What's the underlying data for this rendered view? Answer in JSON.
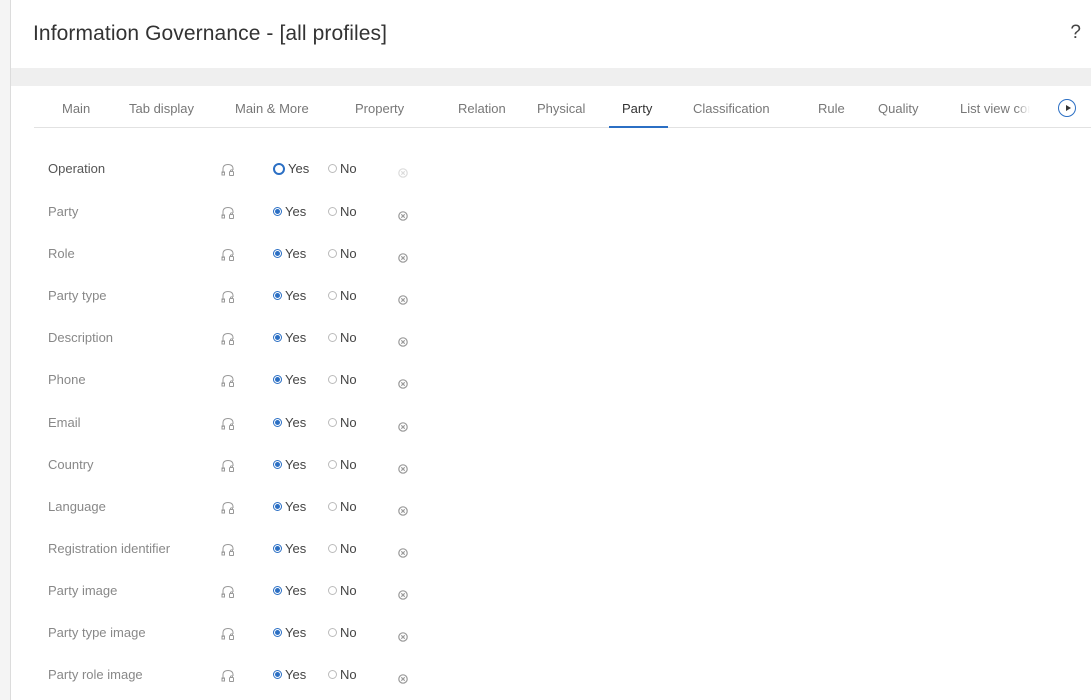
{
  "window": {
    "title": "Information Governance - [all profiles]",
    "help_label": "?"
  },
  "tabs": [
    {
      "label": "Main",
      "active": false
    },
    {
      "label": "Tab display",
      "active": false
    },
    {
      "label": "Main & More",
      "active": false
    },
    {
      "label": "Property",
      "active": false
    },
    {
      "label": "Relation",
      "active": false
    },
    {
      "label": "Physical",
      "active": false
    },
    {
      "label": "Party",
      "active": true
    },
    {
      "label": "Classification",
      "active": false
    },
    {
      "label": "Rule",
      "active": false
    },
    {
      "label": "Quality",
      "active": false
    },
    {
      "label": "List view cor",
      "active": false
    }
  ],
  "colors": {
    "accent": "#2b6fc4",
    "label": "#888888",
    "text": "#444444"
  },
  "fields": [
    {
      "label": "Operation",
      "yes_label": "Yes",
      "no_label": "No",
      "value": "unset"
    },
    {
      "label": "Party",
      "yes_label": "Yes",
      "no_label": "No",
      "value": "yes"
    },
    {
      "label": "Role",
      "yes_label": "Yes",
      "no_label": "No",
      "value": "yes"
    },
    {
      "label": "Party type",
      "yes_label": "Yes",
      "no_label": "No",
      "value": "yes"
    },
    {
      "label": "Description",
      "yes_label": "Yes",
      "no_label": "No",
      "value": "yes"
    },
    {
      "label": "Phone",
      "yes_label": "Yes",
      "no_label": "No",
      "value": "yes"
    },
    {
      "label": "Email",
      "yes_label": "Yes",
      "no_label": "No",
      "value": "yes"
    },
    {
      "label": "Country",
      "yes_label": "Yes",
      "no_label": "No",
      "value": "yes"
    },
    {
      "label": "Language",
      "yes_label": "Yes",
      "no_label": "No",
      "value": "yes"
    },
    {
      "label": "Registration identifier",
      "yes_label": "Yes",
      "no_label": "No",
      "value": "yes"
    },
    {
      "label": "Party image",
      "yes_label": "Yes",
      "no_label": "No",
      "value": "yes"
    },
    {
      "label": "Party type image",
      "yes_label": "Yes",
      "no_label": "No",
      "value": "yes"
    },
    {
      "label": "Party role image",
      "yes_label": "Yes",
      "no_label": "No",
      "value": "yes"
    }
  ]
}
